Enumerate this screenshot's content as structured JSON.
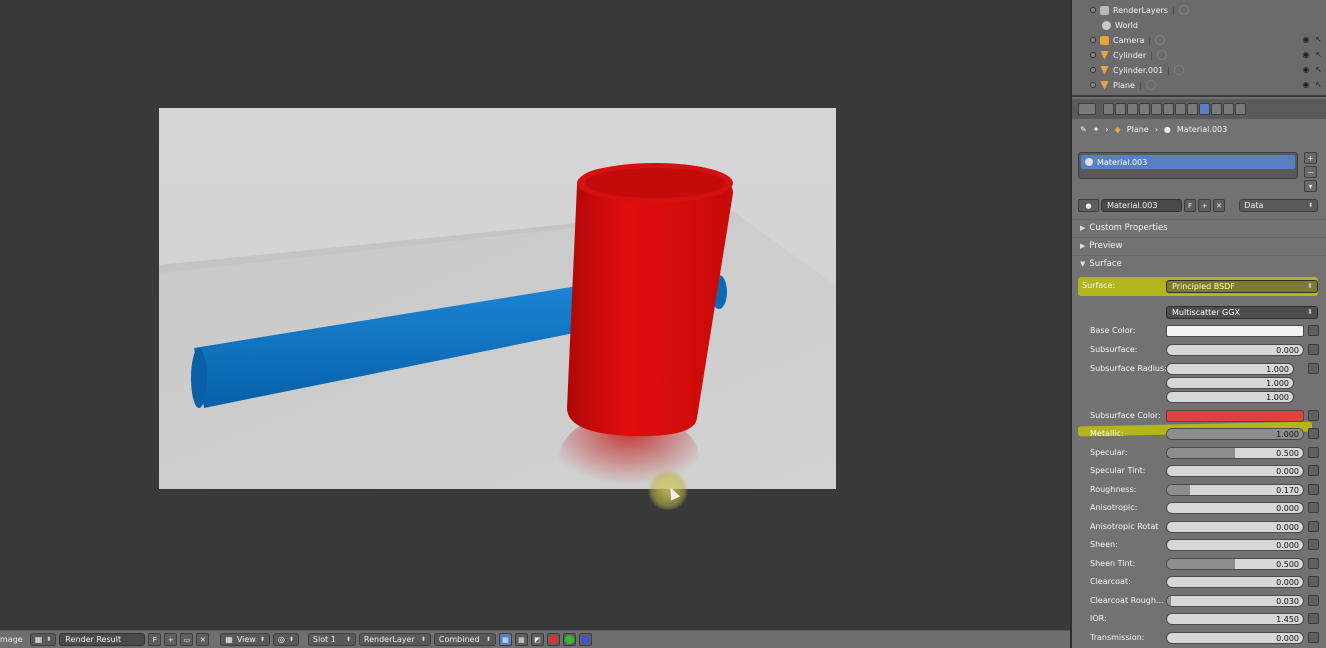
{
  "outliner": {
    "items": [
      {
        "name": "RenderLayers",
        "icon": "render-layers-icon",
        "color": "#b8b8b8"
      },
      {
        "name": "World",
        "icon": "world-icon",
        "color": "#c9c9c9"
      },
      {
        "name": "Camera",
        "icon": "camera-icon",
        "color": "#e8a33d"
      },
      {
        "name": "Cylinder",
        "icon": "mesh-icon",
        "color": "#e8a33d"
      },
      {
        "name": "Cylinder.001",
        "icon": "mesh-icon",
        "color": "#e8a33d"
      },
      {
        "name": "Plane",
        "icon": "mesh-icon",
        "color": "#e8a33d"
      }
    ]
  },
  "breadcrumb": {
    "object": "Plane",
    "material": "Material.003"
  },
  "material_slot": {
    "name": "Material.003"
  },
  "material_field": {
    "name": "Material.003",
    "fake_user": "F",
    "link": "Data"
  },
  "panels": {
    "custom_properties": "Custom Properties",
    "preview": "Preview",
    "surface": "Surface"
  },
  "surface": {
    "label": "Surface:",
    "shader": "Principled BSDF",
    "distribution": "Multiscatter GGX",
    "base_color_label": "Base Color:",
    "base_color": "#f3f3f3",
    "subsurface_label": "Subsurface:",
    "subsurface": "0.000",
    "subsurface_radius_label": "Subsurface Radius:",
    "subsurface_radius": [
      "1.000",
      "1.000",
      "1.000"
    ],
    "subsurface_color_label": "Subsurface Color:",
    "subsurface_color": "#e04040",
    "params": [
      {
        "label": "Metallic:",
        "value": "1.000",
        "fill": 1.0
      },
      {
        "label": "Specular:",
        "value": "0.500",
        "fill": 0.5
      },
      {
        "label": "Specular Tint:",
        "value": "0.000",
        "fill": 0.0
      },
      {
        "label": "Roughness:",
        "value": "0.170",
        "fill": 0.17
      },
      {
        "label": "Anisotropic:",
        "value": "0.000",
        "fill": 0.0
      },
      {
        "label": "Anisotropic Rotat",
        "value": "0.000",
        "fill": 0.0
      },
      {
        "label": "Sheen:",
        "value": "0.000",
        "fill": 0.0
      },
      {
        "label": "Sheen Tint:",
        "value": "0.500",
        "fill": 0.5
      },
      {
        "label": "Clearcoat:",
        "value": "0.000",
        "fill": 0.0
      },
      {
        "label": "Clearcoat Rough...",
        "value": "0.030",
        "fill": 0.03
      },
      {
        "label": "IOR:",
        "value": "1.450",
        "fill": 0.0
      },
      {
        "label": "Transmission:",
        "value": "0.000",
        "fill": 0.0
      }
    ]
  },
  "image_header": {
    "editor_label": "mage",
    "image_name": "Render Result",
    "fake_user": "F",
    "view_menu": "View",
    "slot": "Slot 1",
    "render_layer": "RenderLayer",
    "pass": "Combined"
  },
  "colors": {
    "accent": "#5680c2",
    "highlight": "#c8cd00",
    "handle": "#0a6fbd",
    "head": "#d40d0d"
  }
}
